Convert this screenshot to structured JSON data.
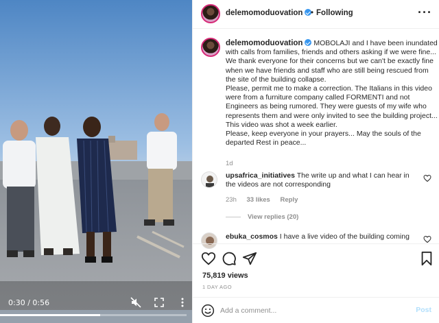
{
  "video": {
    "time": "0:30 / 0:56",
    "progress_fraction": 0.536,
    "icons": [
      "mute-icon",
      "fullscreen-icon",
      "more-vertical-icon"
    ]
  },
  "header": {
    "username": "delemomoduovation",
    "separator": "•",
    "follow_label": "Following",
    "more_icon": "more-horizontal-icon"
  },
  "caption": {
    "username": "delemomoduovation",
    "text": "MOBOLAJI and I have been inundated with calls from families, friends and others asking if we were fine... We thank everyone for their concerns but we can't be exactly fine when we have friends and staff who are still being rescued from the site of the building collapse.\nPlease, permit me to make a correction. The Italians in this video were from a furniture company called FORMENTI and not Engineers as being rumored. They were guests of my wife who represents them and were only invited to see the building project... This video was shot a week earlier.\nPlease, keep everyone in your prayers... May the souls of the departed Rest in peace...",
    "time": "1d"
  },
  "comments": [
    {
      "username": "upsafrica_initiatives",
      "text": "The write up and what I can hear in the videos are not corresponding",
      "time": "23h",
      "likes": "33 likes",
      "reply_label": "Reply",
      "view_replies": "View replies (20)"
    },
    {
      "username": "ebuka_cosmos",
      "text": "I have a live video of the building coming"
    }
  ],
  "actions": {
    "icons": [
      "heart-icon",
      "comment-icon",
      "share-icon",
      "bookmark-icon"
    ]
  },
  "stats": {
    "views": "75,819 views",
    "posted": "1 DAY AGO"
  },
  "add_comment": {
    "placeholder": "Add a comment...",
    "post_label": "Post"
  },
  "colors": {
    "verified": "#3897f0",
    "post_disabled": "#b2dffc",
    "muted_text": "#8e8e8e"
  }
}
